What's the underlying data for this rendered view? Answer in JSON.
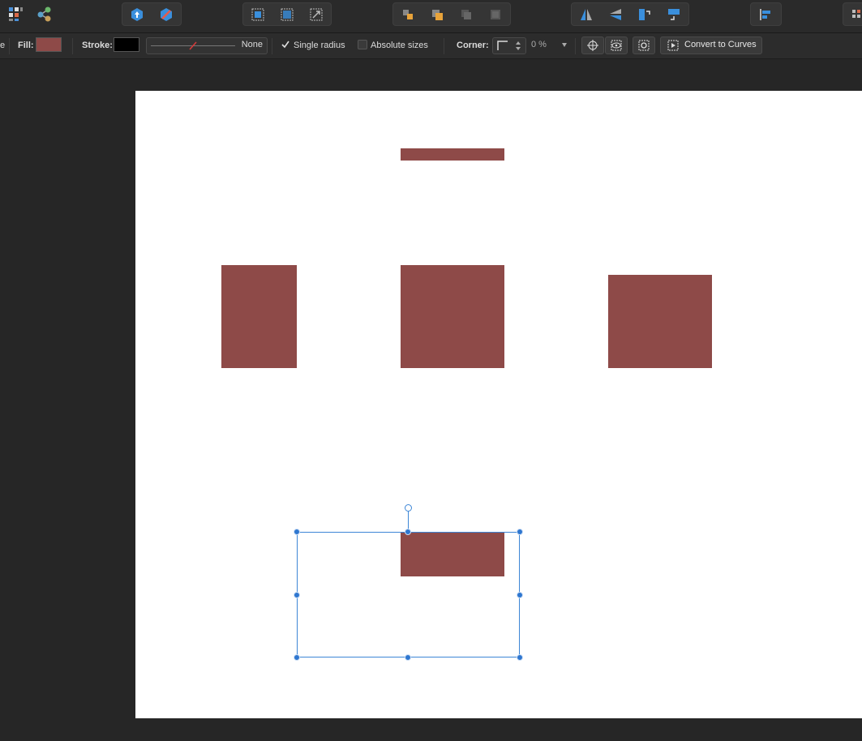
{
  "toolbar": {
    "buttons": [
      {
        "name": "grid-apps-icon"
      },
      {
        "name": "share-nodes-icon"
      },
      {
        "name": "publish-icon"
      },
      {
        "name": "cancel-badge-icon"
      },
      {
        "name": "select-grid-icon"
      },
      {
        "name": "select-bounds-icon"
      },
      {
        "name": "transform-icon"
      },
      {
        "name": "arrange-front-icon"
      },
      {
        "name": "arrange-forward-icon"
      },
      {
        "name": "arrange-backward-icon"
      },
      {
        "name": "arrange-back-icon"
      },
      {
        "name": "flip-horizontal-icon"
      },
      {
        "name": "flip-vertical-icon"
      },
      {
        "name": "rotate-left-icon"
      },
      {
        "name": "rotate-right-icon"
      },
      {
        "name": "align-left-icon"
      },
      {
        "name": "more-grid-icon"
      }
    ]
  },
  "context": {
    "cut_label": "e",
    "fill_label": "Fill:",
    "fill_color": "#8e4a48",
    "stroke_label": "Stroke:",
    "stroke_color": "#000000",
    "stroke_style": "None",
    "single_radius_label": "Single radius",
    "single_radius_checked": true,
    "absolute_sizes_label": "Absolute sizes",
    "absolute_sizes_checked": false,
    "corner_label": "Corner:",
    "corner_value": "0 %",
    "convert_label": "Convert to Curves"
  },
  "canvas": {
    "background": "#ffffff",
    "shape_color": "#8e4a48",
    "selection_color": "#3d86d6"
  }
}
